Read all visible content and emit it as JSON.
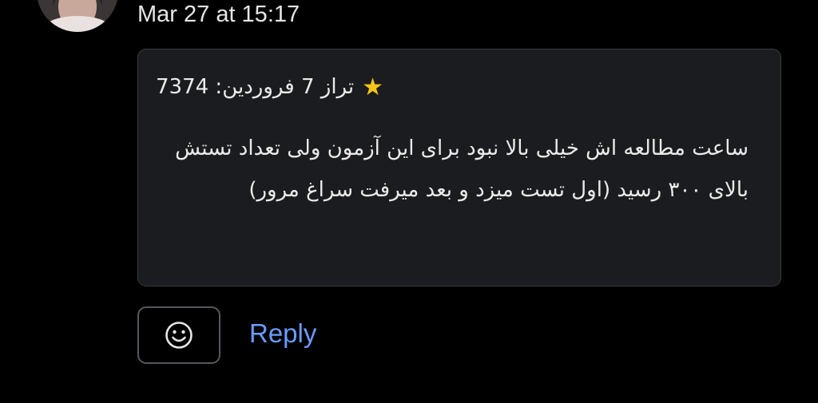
{
  "message": {
    "timestamp": "Mar 27 at 15:17",
    "card": {
      "star_icon": "star-icon",
      "title": "تراز 7 فروردین: 7374",
      "body": "ساعت مطالعه اش خیلی بالا نبود برای این آزمون ولی تعداد تستش بالای ۳۰۰ رسید (اول تست میزد و بعد میرفت سراغ مرور)"
    }
  },
  "actions": {
    "emoji_icon": "smiley-icon",
    "reply_label": "Reply"
  },
  "colors": {
    "background": "#000000",
    "card_background": "#1b1c1f",
    "card_border": "#3a3b3f",
    "link": "#6b9bff",
    "star": "#f5c518"
  }
}
